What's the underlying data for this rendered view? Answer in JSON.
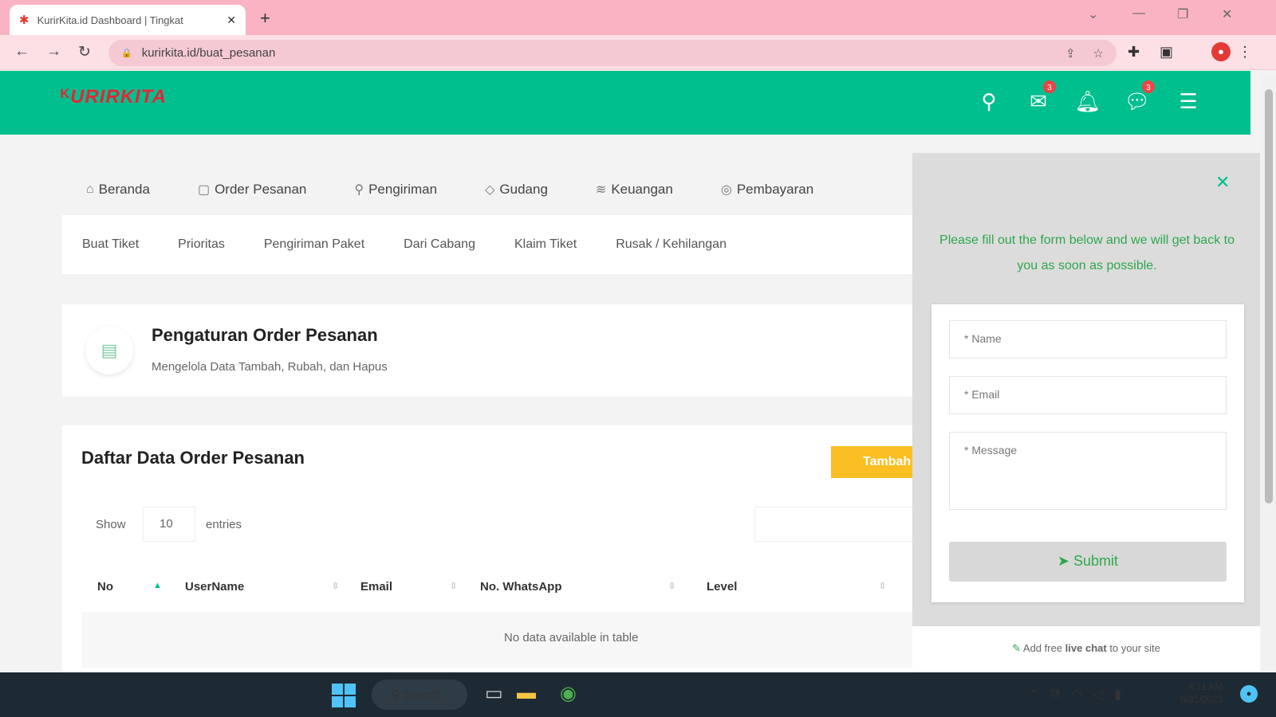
{
  "browser": {
    "tab_title": "KurirKita.id Dashboard | Tingkat",
    "url": "kurirkita.id/buat_pesanan"
  },
  "header": {
    "logo_text": "URIRKITA",
    "mail_badge": "3",
    "chat_badge": "3",
    "accent_color": "#00bf8e"
  },
  "main_nav": [
    {
      "label": "Beranda",
      "icon": "home-icon"
    },
    {
      "label": "Order Pesanan",
      "icon": "box-icon"
    },
    {
      "label": "Pengiriman",
      "icon": "pin-icon"
    },
    {
      "label": "Gudang",
      "icon": "tag-icon"
    },
    {
      "label": "Keuangan",
      "icon": "money-icon"
    },
    {
      "label": "Pembayaran",
      "icon": "payment-icon"
    }
  ],
  "sub_nav": [
    "Buat Tiket",
    "Prioritas",
    "Pengiriman Paket",
    "Dari Cabang",
    "Klaim Tiket",
    "Rusak / Kehilangan"
  ],
  "page_header": {
    "title": "Pengaturan Order Pesanan",
    "subtitle": "Mengelola Data Tambah, Rubah, dan Hapus"
  },
  "table_card": {
    "title": "Daftar Data Order Pesanan",
    "add_button": "Tambah",
    "show_label": "Show",
    "entries_value": "10",
    "entries_label": "entries",
    "columns": [
      "No",
      "UserName",
      "Email",
      "No. WhatsApp",
      "Level"
    ],
    "empty_message": "No data available in table"
  },
  "chat_widget": {
    "message": "Please fill out the form below and we will get back to you as soon as possible.",
    "name_placeholder": "* Name",
    "email_placeholder": "* Email",
    "message_placeholder": "* Message",
    "submit_label": "Submit",
    "footer_prefix": "Add free ",
    "footer_bold": "live chat",
    "footer_suffix": " to your site"
  },
  "taskbar": {
    "search_label": "Search",
    "time": "4:11 AM",
    "date": "5/31/2023"
  }
}
